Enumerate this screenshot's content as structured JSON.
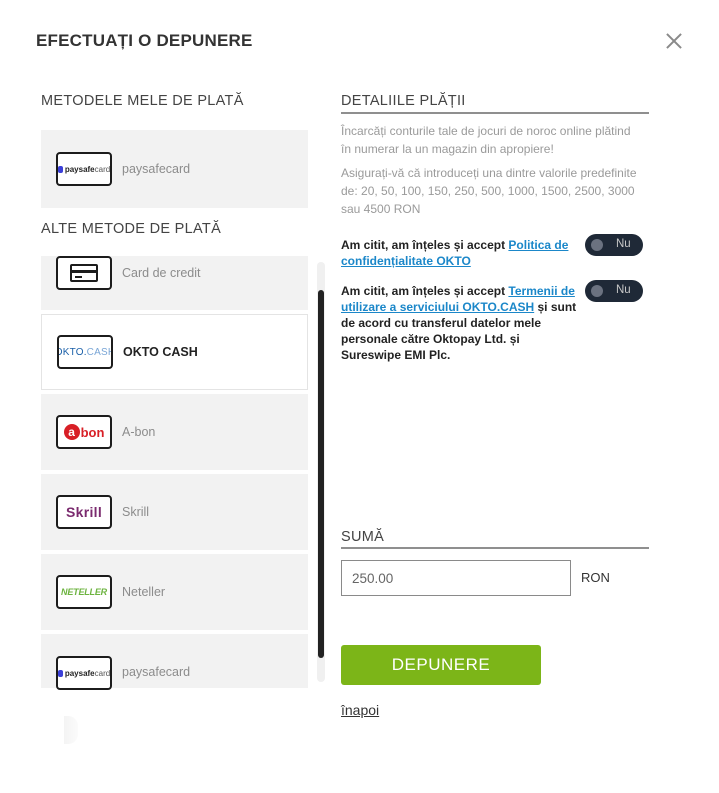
{
  "modal": {
    "title": "EFECTUAȚI O DEPUNERE"
  },
  "my_methods": {
    "heading": "METODELE MELE DE PLATĂ",
    "items": [
      {
        "label": "paysafecard",
        "icon": "paysafecard-logo"
      }
    ]
  },
  "other_methods": {
    "heading": "ALTE METODE DE PLATĂ",
    "items": [
      {
        "label": "Card de credit",
        "icon": "credit-card-icon"
      },
      {
        "label": "OKTO CASH",
        "icon": "okto-cash-logo",
        "selected": true
      },
      {
        "label": "A-bon",
        "icon": "a-bon-logo"
      },
      {
        "label": "Skrill",
        "icon": "skrill-logo"
      },
      {
        "label": "Neteller",
        "icon": "neteller-logo"
      },
      {
        "label": "paysafecard",
        "icon": "paysafecard-logo"
      }
    ]
  },
  "logos": {
    "paysafe": "paysafe",
    "card": "card",
    "okto": "OKTO.",
    "cash": "CASH",
    "abon_a": "a",
    "abon_rest": "bon",
    "skrill": "Skrill",
    "neteller": "NETELLER"
  },
  "details": {
    "heading": "DETALIILE PLĂȚII",
    "info1": "Încarcăți conturile tale de jocuri de noroc online plătind în numerar la un magazin din apropiere!",
    "info2": "Asigurați-vă că introduceți una dintre valorile predefinite de: 20, 50, 100, 150, 250, 500, 1000, 1500, 2500, 3000 sau 4500 RON",
    "terms1": {
      "text": "Am citit, am înțeles și accept ",
      "link": "Politica de confidențialitate OKTO",
      "toggle": "Nu"
    },
    "terms2": {
      "text": "Am citit, am înțeles și accept ",
      "link": "Termenii de utilizare a serviciului OKTO.CASH",
      "text_after": " și sunt de acord cu transferul datelor mele personale către Oktopay Ltd. și Sureswipe EMI Plc.",
      "toggle": "Nu"
    }
  },
  "amount": {
    "heading": "SUMĂ",
    "value": "250.00",
    "currency": "RON"
  },
  "actions": {
    "deposit": "DEPUNERE",
    "back": "înapoi"
  },
  "colors": {
    "accent_green": "#7cb518",
    "link_blue": "#1b87c9",
    "toggle_bg": "#1f2937"
  }
}
